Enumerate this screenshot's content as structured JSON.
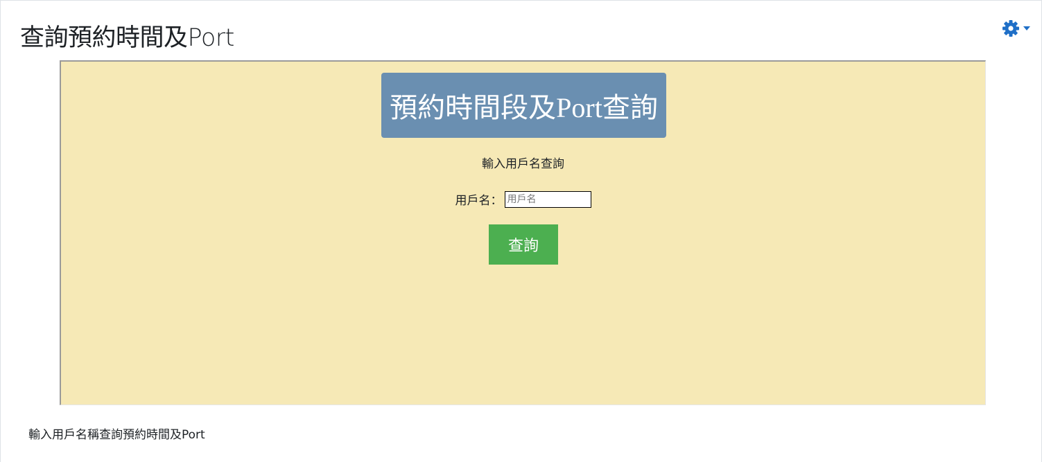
{
  "header": {
    "title": "查詢預約時間及Port",
    "settings_icon": "gear-icon",
    "accent_color": "#1f6fc7"
  },
  "panel": {
    "banner_title": "預約時間段及Port查詢",
    "subheading": "輸入用戶名查詢",
    "username_label": "用戶名：",
    "username_placeholder": "用戶名",
    "username_value": "",
    "query_button_label": "查詢",
    "background_color": "#f6e9b6",
    "banner_color": "#6a8fb1",
    "button_color": "#4caf50"
  },
  "footer": {
    "description": "輸入用戶名稱查詢預約時間及Port"
  }
}
